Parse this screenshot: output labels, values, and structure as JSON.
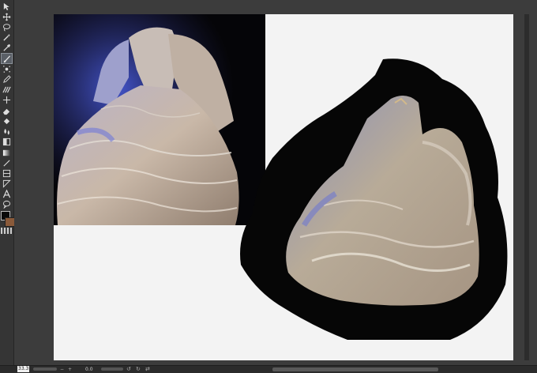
{
  "toolbar": {
    "tools": [
      {
        "name": "selection-arrow-icon"
      },
      {
        "name": "move-icon"
      },
      {
        "name": "lasso-icon"
      },
      {
        "name": "magic-wand-icon"
      },
      {
        "name": "eyedropper-icon"
      },
      {
        "name": "brush-icon",
        "active": true
      },
      {
        "name": "airbrush-icon"
      },
      {
        "name": "pen-icon"
      },
      {
        "name": "texture-icon"
      },
      {
        "name": "blend-icon"
      },
      {
        "name": "eraser-icon"
      },
      {
        "name": "fill-bucket-icon"
      },
      {
        "name": "water-drop-icon"
      },
      {
        "name": "fill-icon"
      },
      {
        "name": "gradient-icon"
      },
      {
        "name": "line-icon"
      },
      {
        "name": "frame-icon"
      },
      {
        "name": "ruler-icon"
      },
      {
        "name": "text-icon"
      },
      {
        "name": "balloon-icon"
      },
      {
        "name": "correction-icon"
      }
    ],
    "foreground_color": "#0a0a0a",
    "background_color": "#8a5a3a"
  },
  "canvas": {
    "background": "#f3f3f3"
  },
  "statusbar": {
    "zoom": "33.3",
    "zoom_out": "−",
    "zoom_in": "+",
    "angle": "0.0",
    "rotate_left": "↺",
    "rotate_reset": "↻",
    "flip": "⇄"
  }
}
